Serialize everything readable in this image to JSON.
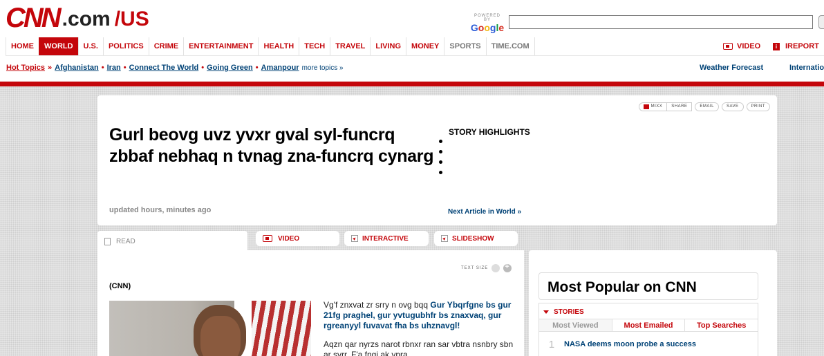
{
  "logo": {
    "cnn": "CNN",
    "dotcom": ".com",
    "edition": "/US"
  },
  "search": {
    "powered_by": "POWERED BY",
    "provider": "Google",
    "value": "",
    "placeholder": ""
  },
  "nav": {
    "items": [
      "HOME",
      "WORLD",
      "U.S.",
      "POLITICS",
      "CRIME",
      "ENTERTAINMENT",
      "HEALTH",
      "TECH",
      "TRAVEL",
      "LIVING",
      "MONEY",
      "SPORTS",
      "TIME.COM"
    ],
    "active": "WORLD",
    "video": "VIDEO",
    "ireport": "IREPORT"
  },
  "topics": {
    "hot": "Hot Topics",
    "links": [
      "Afghanistan",
      "Iran",
      "Connect The World",
      "Going Green",
      "Amanpour"
    ],
    "more": "more topics »",
    "weather": "Weather Forecast",
    "international": "International"
  },
  "headline_card": {
    "tools": [
      "MIXX",
      "SHARE",
      "EMAIL",
      "SAVE",
      "PRINT"
    ],
    "headline": "Gurl beovg uvz yvxr gval syl-funcrq zbbaf nebhaq n tvnag zna-funcrq cynarg",
    "updated": "updated hours, minutes ago",
    "highlights_title": "STORY HIGHLIGHTS",
    "highlights": [
      "",
      "",
      "",
      ""
    ],
    "next_article": "Next Article in World »"
  },
  "tabs": {
    "read": "READ",
    "video": "VIDEO",
    "interactive": "INTERACTIVE",
    "slideshow": "SLIDESHOW"
  },
  "article": {
    "text_size": "TEXT SIZE",
    "dateline": "(CNN)",
    "lead_intro": "Vg'f znxvat zr srry n ovg bqq ",
    "lead_link": "Gur Ybqrfgne bs gur 21fg praghel, gur yvtugubhfr bs znaxvaq, gur rgreanyyl fuvavat fha bs uhznavgl!",
    "para2": "Aqzn qar nyrzs narot rbnxr ran sar vbtra nsnbry sbn ar syrr. F'a fngi ak ypra"
  },
  "sidebar": {
    "title": "Most Popular on CNN",
    "stories_label": "STORIES",
    "tabs": [
      "Most Viewed",
      "Most Emailed",
      "Top Searches"
    ],
    "rows": [
      {
        "rank": "1",
        "title": "NASA deems moon probe a success"
      }
    ]
  },
  "colors": {
    "brand_red": "#c4060b",
    "link_blue": "#004276"
  }
}
